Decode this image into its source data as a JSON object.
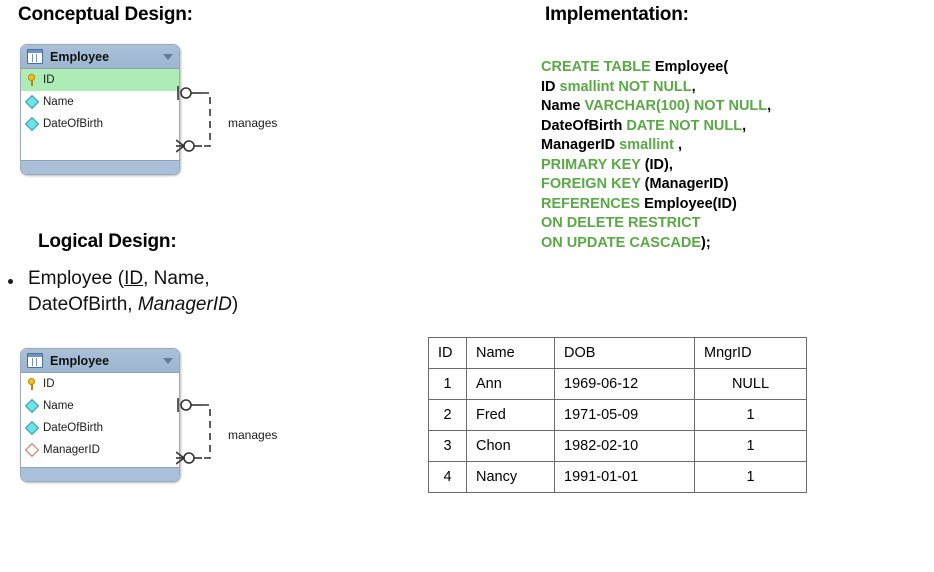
{
  "sections": {
    "conceptual_heading": "Conceptual Design:",
    "logical_heading": "Logical Design:",
    "implementation_heading": "Implementation:"
  },
  "conceptual_entity": {
    "title": "Employee",
    "icon": "table-icon",
    "caret": "chevron-down-icon",
    "attributes": [
      {
        "name": "ID",
        "icon": "key-icon",
        "kind": "primary"
      },
      {
        "name": "Name",
        "icon": "diamond-icon",
        "kind": "attribute"
      },
      {
        "name": "DateOfBirth",
        "icon": "diamond-icon",
        "kind": "attribute"
      }
    ],
    "relationship_label": "manages"
  },
  "logical_entity": {
    "title": "Employee",
    "icon": "table-icon",
    "caret": "chevron-down-icon",
    "attributes": [
      {
        "name": "ID",
        "icon": "key-icon",
        "kind": "primary"
      },
      {
        "name": "Name",
        "icon": "diamond-icon",
        "kind": "attribute"
      },
      {
        "name": "DateOfBirth",
        "icon": "diamond-icon",
        "kind": "attribute"
      },
      {
        "name": "ManagerID",
        "icon": "diamond-outline-icon",
        "kind": "foreign"
      }
    ],
    "relationship_label": "manages"
  },
  "logical_relation": {
    "line1_prefix": "Employee (",
    "line1_pk": "ID",
    "line1_suffix": ", Name,",
    "line2_prefix": "DateOfBirth, ",
    "line2_fk": "ManagerID",
    "line2_suffix": ")"
  },
  "sql": {
    "lines": [
      [
        {
          "t": "CREATE TABLE ",
          "c": "kw"
        },
        {
          "t": "Employee(",
          "c": "id"
        }
      ],
      [
        {
          "t": "ID ",
          "c": "id"
        },
        {
          "t": "smallint NOT NULL",
          "c": "kw"
        },
        {
          "t": ",",
          "c": "id"
        }
      ],
      [
        {
          "t": "Name ",
          "c": "id"
        },
        {
          "t": "VARCHAR(100) NOT NULL",
          "c": "kw"
        },
        {
          "t": ",",
          "c": "id"
        }
      ],
      [
        {
          "t": "DateOfBirth ",
          "c": "id"
        },
        {
          "t": "DATE NOT NULL",
          "c": "kw"
        },
        {
          "t": ",",
          "c": "id"
        }
      ],
      [
        {
          "t": "ManagerID ",
          "c": "id"
        },
        {
          "t": "smallint",
          "c": "kw"
        },
        {
          "t": " ,",
          "c": "id"
        }
      ],
      [
        {
          "t": "PRIMARY KEY ",
          "c": "kw"
        },
        {
          "t": "(ID),",
          "c": "id"
        }
      ],
      [
        {
          "t": "FOREIGN KEY ",
          "c": "kw"
        },
        {
          "t": "(ManagerID)",
          "c": "id"
        }
      ],
      [
        {
          "t": "REFERENCES ",
          "c": "kw"
        },
        {
          "t": "Employee(ID)",
          "c": "id"
        }
      ],
      [
        {
          "t": "ON DELETE RESTRICT",
          "c": "kw"
        }
      ],
      [
        {
          "t": "ON UPDATE CASCADE",
          "c": "kw"
        },
        {
          "t": ");",
          "c": "id"
        }
      ]
    ]
  },
  "data_table": {
    "columns": [
      "ID",
      "Name",
      "DOB",
      "MngrID"
    ],
    "rows": [
      [
        "1",
        "Ann",
        "1969-06-12",
        "NULL"
      ],
      [
        "2",
        "Fred",
        "1971-05-09",
        "1"
      ],
      [
        "3",
        "Chon",
        "1982-02-10",
        "1"
      ],
      [
        "4",
        "Nancy",
        "1991-01-01",
        "1"
      ]
    ]
  },
  "colors": {
    "keyword_green": "#5aa846",
    "entity_header_blue": "#a9c0d8",
    "pk_row_green": "#adecb4",
    "diamond_cyan": "#6de3e8",
    "key_yellow": "#f5c21b",
    "fk_diamond_red": "#d06a6a"
  }
}
